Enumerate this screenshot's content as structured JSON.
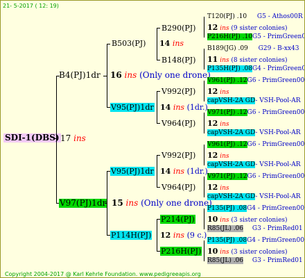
{
  "header": "21-  5-2017 ( 12: 19)",
  "footer": "Copyright 2004-2017 @ Karl Kehrle Foundation.   www.pedigreeapis.org",
  "root": {
    "name": "SDI-1(DBS)",
    "num": "17",
    "ins": "ins"
  },
  "g1": [
    {
      "name": "B4(PJ)1dr",
      "num": "16",
      "ins": "ins",
      "note": "(Only one drone)"
    },
    {
      "name": "V97(PJ)1dr",
      "num": "15",
      "ins": "ins",
      "note": "(Only one drone)"
    }
  ],
  "g2": [
    {
      "name": "B503(PJ)",
      "num": "14",
      "ins": "ins"
    },
    {
      "name": "V95(PJ)1dr",
      "num": "14",
      "ins": "ins",
      "note": "(1dr.)"
    },
    {
      "name": "V95(PJ)1dr",
      "num": "14",
      "ins": "ins",
      "note": "(1dr.)"
    },
    {
      "name": "P114H(PJ)",
      "num": "12",
      "ins": "ins",
      "note": "(9 c.)"
    }
  ],
  "g3": [
    {
      "name": "B290(PJ)"
    },
    {
      "name": "B148(PJ)"
    },
    {
      "name": "V992(PJ)"
    },
    {
      "name": "V964(PJ)"
    },
    {
      "name": "V992(PJ)"
    },
    {
      "name": "V964(PJ)"
    },
    {
      "name": "P214(PJ)"
    },
    {
      "name": "P216H(PJ)"
    }
  ],
  "g4": [
    {
      "top": "T120(PJ) .10",
      "topRight": "G5 - Athos00R",
      "mid": "12",
      "midNote": "(9 sister colonies)",
      "bot": "P216H(PJ) .10",
      "botRight": "G5 - PrimGreen00"
    },
    {
      "top": "B189(JG) .09",
      "topRight": "G29 - B-xx43",
      "mid": "11",
      "midNote": "(8 sister colonies)",
      "bot": "P135H(PJ) .08",
      "botRight": "G4 - PrimGreen00"
    },
    {
      "top": "V961(PJ) .12",
      "topRight": "G6 - PrimGreen00",
      "mid": "12",
      "midNote": "",
      "bot": "capVSH-2A GD",
      "botRight": "- VSH-Pool-AR"
    },
    {
      "top": "V971(PJ) .12",
      "topRight": "G6 - PrimGreen00",
      "mid": "12",
      "midNote": "",
      "bot": "capVSH-2A GD",
      "botRight": "- VSH-Pool-AR"
    },
    {
      "top": "V961(PJ) .12",
      "topRight": "G6 - PrimGreen00",
      "mid": "12",
      "midNote": "",
      "bot": "capVSH-2A GD",
      "botRight": "- VSH-Pool-AR"
    },
    {
      "top": "V971(PJ) .12",
      "topRight": "G6 - PrimGreen00",
      "mid": "12",
      "midNote": "",
      "bot": "capVSH-2A GD",
      "botRight": "- VSH-Pool-AR"
    },
    {
      "top": "P135(PJ) .08",
      "topRight": "G4 - PrimGreen00",
      "mid": "10",
      "midNote": "(3 sister colonies)",
      "bot": "R85(JL) .06",
      "botRight": "G3 - PrimRed01"
    },
    {
      "top": "P135(PJ) .08",
      "topRight": "G4 - PrimGreen00",
      "mid": "10",
      "midNote": "(3 sister colonies)",
      "bot": "R85(JL) .06",
      "botRight": "G3 - PrimRed01"
    }
  ],
  "insLabel": "ins",
  "colors": {
    "green": "#00d800",
    "cyan": "#00e4f0",
    "pink": "#f2caf6",
    "grey": "#b0b0b0",
    "red": "#ff0000",
    "blue": "#0000c8"
  }
}
